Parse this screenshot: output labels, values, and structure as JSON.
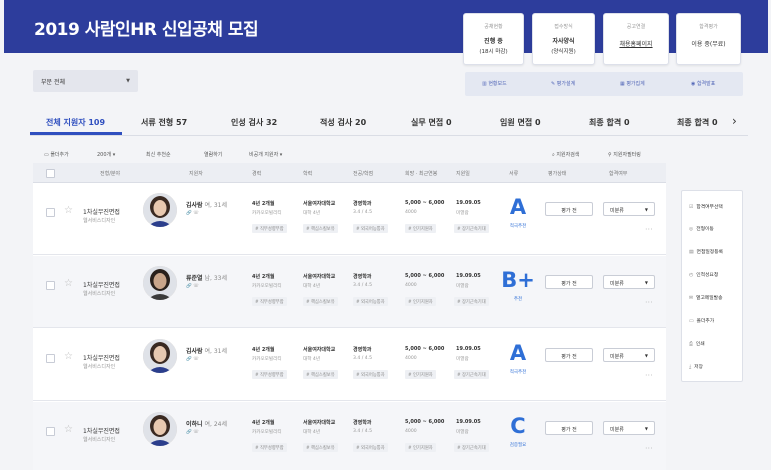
{
  "header": {
    "title": "2019 사람인HR 신입공채 모집",
    "cards": [
      {
        "label": "공채현황",
        "line1": "진행 중",
        "line2": "(18시 마감)"
      },
      {
        "label": "접수방식",
        "line1": "자사양식",
        "line2": "(양식지원)"
      },
      {
        "label": "공고연결",
        "line1": "채용홈페이지",
        "line2": ""
      },
      {
        "label": "합격평가",
        "line1": "이용 중(무료)",
        "line2": ""
      }
    ]
  },
  "filter": {
    "part_select": "부문 전체"
  },
  "toolbar_buttons": [
    "현황보드",
    "평가설계",
    "평가집계",
    "합격발표"
  ],
  "tabs": [
    "전체 지원자 109",
    "서류 전형 57",
    "인성 검사 32",
    "적성 검사 20",
    "실무 면접 0",
    "임원 면접 0",
    "최종 합격 0",
    "최종 합격 0"
  ],
  "tools": {
    "add_folder": "폴더추가",
    "page_size": "200개",
    "sort": "최신 추천순",
    "evaluator": "열람하기",
    "status": "비공개 지원자",
    "search": "지원자검색",
    "filter": "지원자필터링"
  },
  "columns": [
    "전형/분야",
    "지원자",
    "경력",
    "학력",
    "전공/학점",
    "희망 · 최근연봉",
    "지원일",
    "서류",
    "평가상태",
    "합격여부"
  ],
  "rows": [
    {
      "stage": "1차실무진면접",
      "field": "웹서비스디자인",
      "name": "김사람",
      "meta": "여, 31세",
      "career": "4년 2개월",
      "career2": "카카오모빌리티",
      "school": "서울여자대학교",
      "school2": "대학 4년",
      "major": "경영학과",
      "gpa": "3.4 / 4.5",
      "salary": "5,000 ~ 6,000",
      "salary2": "4000",
      "date": "19.09.05",
      "date2": "미열람",
      "tags": [
        "# 직무성향부합",
        "# 핵심스킬보유",
        "# 외국어능통자",
        "# 인기지원자",
        "# 장기근속기대"
      ],
      "grade": "A",
      "grade_sub": "적극추천",
      "eval": "평가 전",
      "result": "미분류",
      "avatar": "female"
    },
    {
      "stage": "1차실무진면접",
      "field": "웹서비스디자인",
      "name": "류준열",
      "meta": "남, 33세",
      "career": "4년 2개월",
      "career2": "카카오모빌리티",
      "school": "서울여자대학교",
      "school2": "대학 4년",
      "major": "경영학과",
      "gpa": "3.4 / 4.5",
      "salary": "5,000 ~ 6,000",
      "salary2": "4000",
      "date": "19.09.05",
      "date2": "미열람",
      "tags": [
        "# 직무성향부합",
        "# 핵심스킬보유",
        "# 외국어능통자",
        "# 인기지원자",
        "# 장기근속기대"
      ],
      "grade": "B+",
      "grade_sub": "추천",
      "eval": "평가 전",
      "result": "미분류",
      "avatar": "male"
    },
    {
      "stage": "1차실무진면접",
      "field": "웹서비스디자인",
      "name": "김사람",
      "meta": "여, 31세",
      "career": "4년 2개월",
      "career2": "카카오모빌리티",
      "school": "서울여자대학교",
      "school2": "대학 4년",
      "major": "경영학과",
      "gpa": "3.4 / 4.5",
      "salary": "5,000 ~ 6,000",
      "salary2": "4000",
      "date": "19.09.05",
      "date2": "미열람",
      "tags": [
        "# 직무성향부합",
        "# 핵심스킬보유",
        "# 외국어능통자",
        "# 인기지원자",
        "# 장기근속기대"
      ],
      "grade": "A",
      "grade_sub": "적극추천",
      "eval": "평가 전",
      "result": "미분류",
      "avatar": "female"
    },
    {
      "stage": "1차실무진면접",
      "field": "웹서비스디자인",
      "name": "이하니",
      "meta": "여, 24세",
      "career": "4년 2개월",
      "career2": "카카오모빌리티",
      "school": "서울여자대학교",
      "school2": "대학 4년",
      "major": "경영학과",
      "gpa": "3.4 / 4.5",
      "salary": "5,000 ~ 6,000",
      "salary2": "4000",
      "date": "19.09.05",
      "date2": "미열람",
      "tags": [
        "# 직무성향부합",
        "# 핵심스킬보유",
        "# 외국어능통자",
        "# 인기지원자",
        "# 장기근속기대"
      ],
      "grade": "C",
      "grade_sub": "검증필요",
      "eval": "평가 전",
      "result": "미분류",
      "avatar": "female2"
    }
  ],
  "side_menu": [
    "합격여부선택",
    "전형이동",
    "면접일정등록",
    "인적성요청",
    "열고메일발송",
    "폴더추가",
    "인쇄",
    "저장"
  ]
}
